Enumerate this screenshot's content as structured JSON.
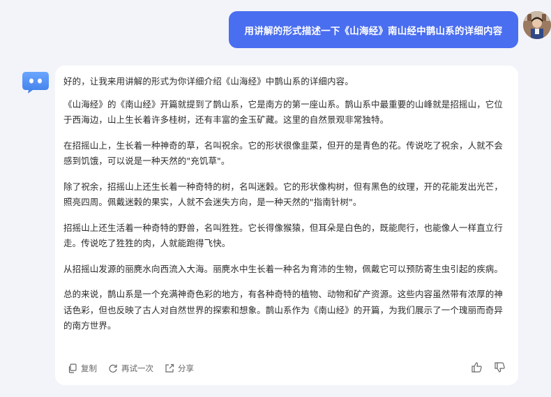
{
  "user_message": "用讲解的形式描述一下《山海经》南山经中鹊山系的详细内容",
  "assistant_paragraphs": [
    "好的，让我来用讲解的形式为你详细介绍《山海经》中鹊山系的详细内容。",
    "《山海经》的《南山经》开篇就提到了鹊山系，它是南方的第一座山系。鹊山系中最重要的山峰就是招摇山，它位于西海边，山上生长着许多桂树，还有丰富的金玉矿藏。这里的自然景观非常独特。",
    "在招摇山上，生长着一种神奇的草，名叫祝余。它的形状很像韭菜，但开的是青色的花。传说吃了祝余，人就不会感到饥饿，可以说是一种天然的\"充饥草\"。",
    "除了祝余，招摇山上还生长着一种奇特的树，名叫迷榖。它的形状像构树，但有黑色的纹理，开的花能发出光芒，照亮四周。佩戴迷榖的果实，人就不会迷失方向，是一种天然的\"指南针树\"。",
    "招摇山上还生活着一种奇特的野兽，名叫狌狌。它长得像猴猿，但耳朵是白色的，既能爬行，也能像人一样直立行走。传说吃了狌狌的肉，人就能跑得飞快。",
    "从招摇山发源的丽麂水向西流入大海。丽麂水中生长着一种名为育沛的生物，佩戴它可以预防寄生虫引起的疾病。",
    "总的来说，鹊山系是一个充满神奇色彩的地方，有各种奇特的植物、动物和矿产资源。这些内容虽然带有浓厚的神话色彩，但也反映了古人对自然世界的探索和想象。鹊山系作为《南山经》的开篇，为我们展示了一个瑰丽而奇异的南方世界。"
  ],
  "actions": {
    "copy": "复制",
    "retry": "再试一次",
    "share": "分享"
  },
  "icons": [
    "copy-icon",
    "retry-icon",
    "share-icon",
    "thumbs-up-icon",
    "thumbs-down-icon"
  ],
  "colors": {
    "user_bubble": "#4a6ef0",
    "page_bg": "#f3f4f9",
    "bot_avatar": "#4e8ff0"
  }
}
